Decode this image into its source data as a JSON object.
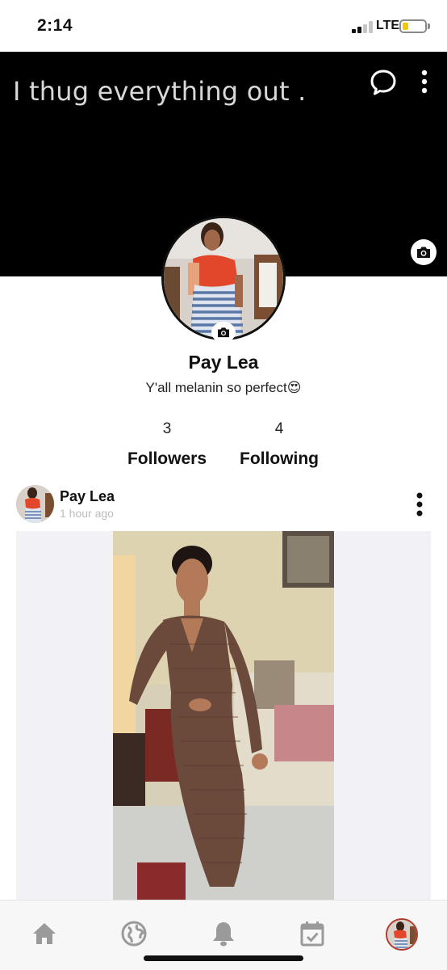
{
  "status_bar": {
    "time": "2:14",
    "network": "LTE",
    "battery_level": 0.2,
    "battery_color": "#f4c700"
  },
  "cover": {
    "text": "I thug everything out .",
    "icons": [
      "chat-bubble-icon",
      "more-vertical-icon",
      "camera-icon"
    ]
  },
  "profile": {
    "name": "Pay Lea",
    "bio": "Y'all melanin so perfect😍",
    "avatar_icon": "camera-icon"
  },
  "stats": {
    "followers_count": "3",
    "followers_label": "Followers",
    "following_count": "4",
    "following_label": "Following"
  },
  "post": {
    "author": "Pay Lea",
    "time": "1 hour ago",
    "menu_icon": "more-vertical-icon"
  },
  "bottom_nav": {
    "items": [
      "home-icon",
      "globe-icon",
      "bell-icon",
      "calendar-check-icon",
      "profile-avatar"
    ],
    "active_color": "#b23a2b",
    "inactive_color": "#9a9a9a"
  }
}
